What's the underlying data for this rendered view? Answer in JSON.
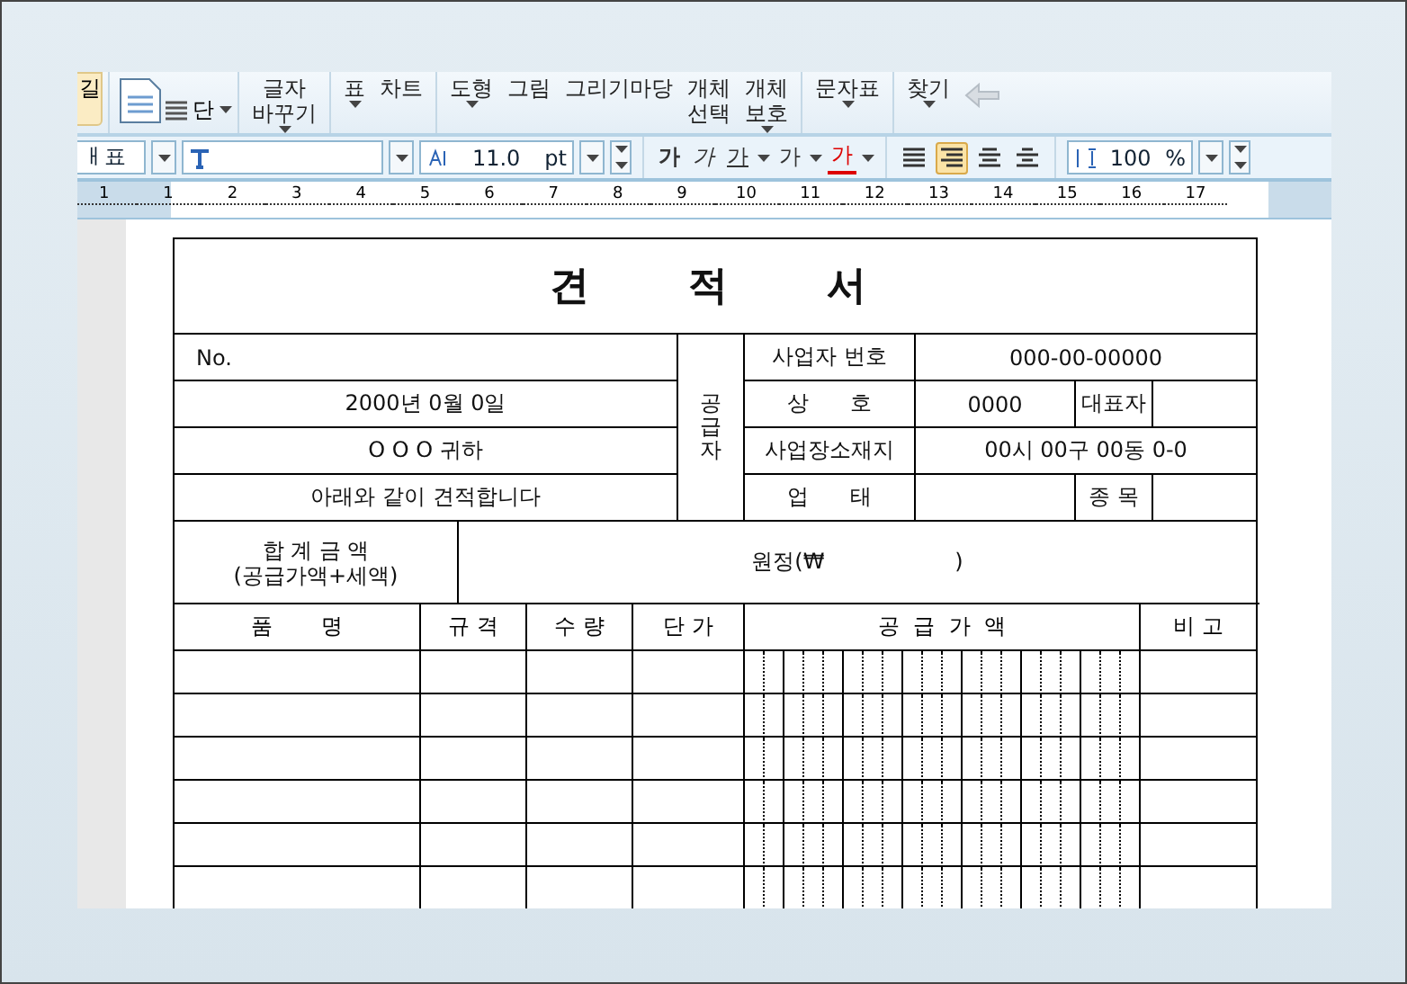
{
  "ribbon": [
    {
      "kind": "button",
      "lines": [
        "길"
      ]
    },
    {
      "kind": "doc-icon"
    },
    {
      "kind": "small",
      "lines": [
        "단"
      ],
      "caret": true
    },
    {
      "kind": "large",
      "lines": [
        "글자",
        "바꾸기"
      ],
      "caret": true
    },
    {
      "kind": "large",
      "lines": [
        "표"
      ],
      "caret": true
    },
    {
      "kind": "large",
      "lines": [
        "차트"
      ]
    },
    {
      "kind": "large",
      "lines": [
        "도형"
      ],
      "caret": true
    },
    {
      "kind": "large",
      "lines": [
        "그림"
      ]
    },
    {
      "kind": "large",
      "lines": [
        "그리기마당"
      ]
    },
    {
      "kind": "large",
      "lines": [
        "개체",
        "선택"
      ]
    },
    {
      "kind": "large",
      "lines": [
        "개체",
        "보호"
      ],
      "caret": true
    },
    {
      "kind": "large",
      "lines": [
        "문자표"
      ],
      "caret": true
    },
    {
      "kind": "large",
      "lines": [
        "찾기"
      ],
      "caret": true
    }
  ],
  "format_bar": {
    "style": "ㅐ표",
    "font_size": "11.0",
    "size_unit": "pt",
    "char_buttons": [
      "가",
      "가",
      "가",
      "가",
      "가"
    ],
    "align": [
      {
        "selected": false
      },
      {
        "selected": true
      },
      {
        "selected": false
      },
      {
        "selected": false
      }
    ],
    "line_spacing": "100",
    "spacing_unit": "%"
  },
  "ruler": [
    "1",
    "1",
    "2",
    "3",
    "4",
    "5",
    "6",
    "7",
    "8",
    "9",
    "10",
    "11",
    "12",
    "13",
    "14",
    "15",
    "16",
    "17"
  ],
  "quote": {
    "title": "견 적 서",
    "number": "No.",
    "date": "2000년 0월 0일",
    "recipient": "O O O 귀하",
    "note": "아래와 같이 견적합니다",
    "supplier_label": "공급자",
    "reg_label": "사업자 번호",
    "reg_value": "000-00-00000",
    "name_label": "상      호",
    "name_value": "0000",
    "rep_label": "대표자",
    "addr_label": "사업장소재지",
    "addr_value": "00시 00구 00동 0-0",
    "biz_label": "업      태",
    "item_label": "종 목",
    "total_label": [
      "합 계 금 액",
      "(공급가액+세액)"
    ],
    "total_value": "원정(₩                   )",
    "columns": [
      "품       명",
      "규 격",
      "수 량",
      "단 가",
      "공  급  가  액",
      "비 고"
    ]
  }
}
